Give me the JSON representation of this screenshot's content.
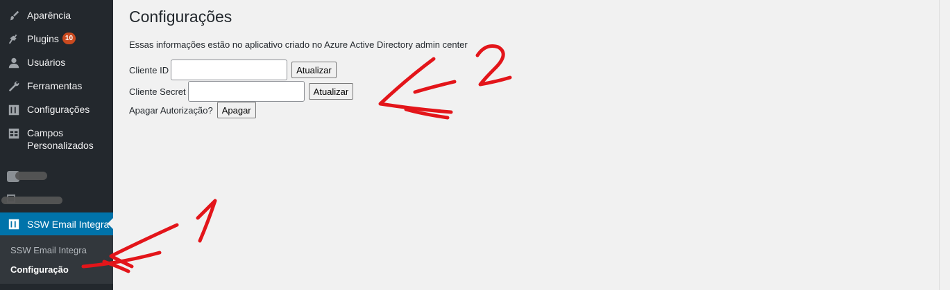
{
  "sidebar": {
    "items": [
      {
        "label": "Aparência",
        "icon": "paintbrush-icon"
      },
      {
        "label": "Plugins",
        "icon": "plug-icon",
        "badge": "10"
      },
      {
        "label": "Usuários",
        "icon": "user-icon"
      },
      {
        "label": "Ferramentas",
        "icon": "wrench-icon"
      },
      {
        "label": "Configurações",
        "icon": "settings-sliders-icon"
      },
      {
        "label": "Campos",
        "label2": "Personalizados",
        "icon": "table-icon"
      }
    ],
    "active": {
      "label": "SSW Email Integra",
      "icon": "settings-sliders-icon"
    },
    "submenu": [
      {
        "label": "SSW Email Integra"
      },
      {
        "label": "Configuração"
      }
    ]
  },
  "main": {
    "title": "Configurações",
    "description": "Essas informações estão no aplicativo criado no Azure Active Directory admin center",
    "client_id": {
      "label": "Cliente ID",
      "value": "",
      "button": "Atualizar"
    },
    "client_secret": {
      "label": "Cliente Secret",
      "value": "",
      "button": "Atualizar"
    },
    "delete_auth": {
      "label": "Apagar Autorização?",
      "button": "Apagar"
    }
  },
  "annotations": {
    "num1": "1",
    "num2": "2",
    "color": "#e3151a"
  },
  "colors": {
    "sidebar_bg": "#23282d",
    "active_bg": "#0073aa",
    "badge_bg": "#ca4a1f",
    "page_bg": "#f1f1f1"
  }
}
